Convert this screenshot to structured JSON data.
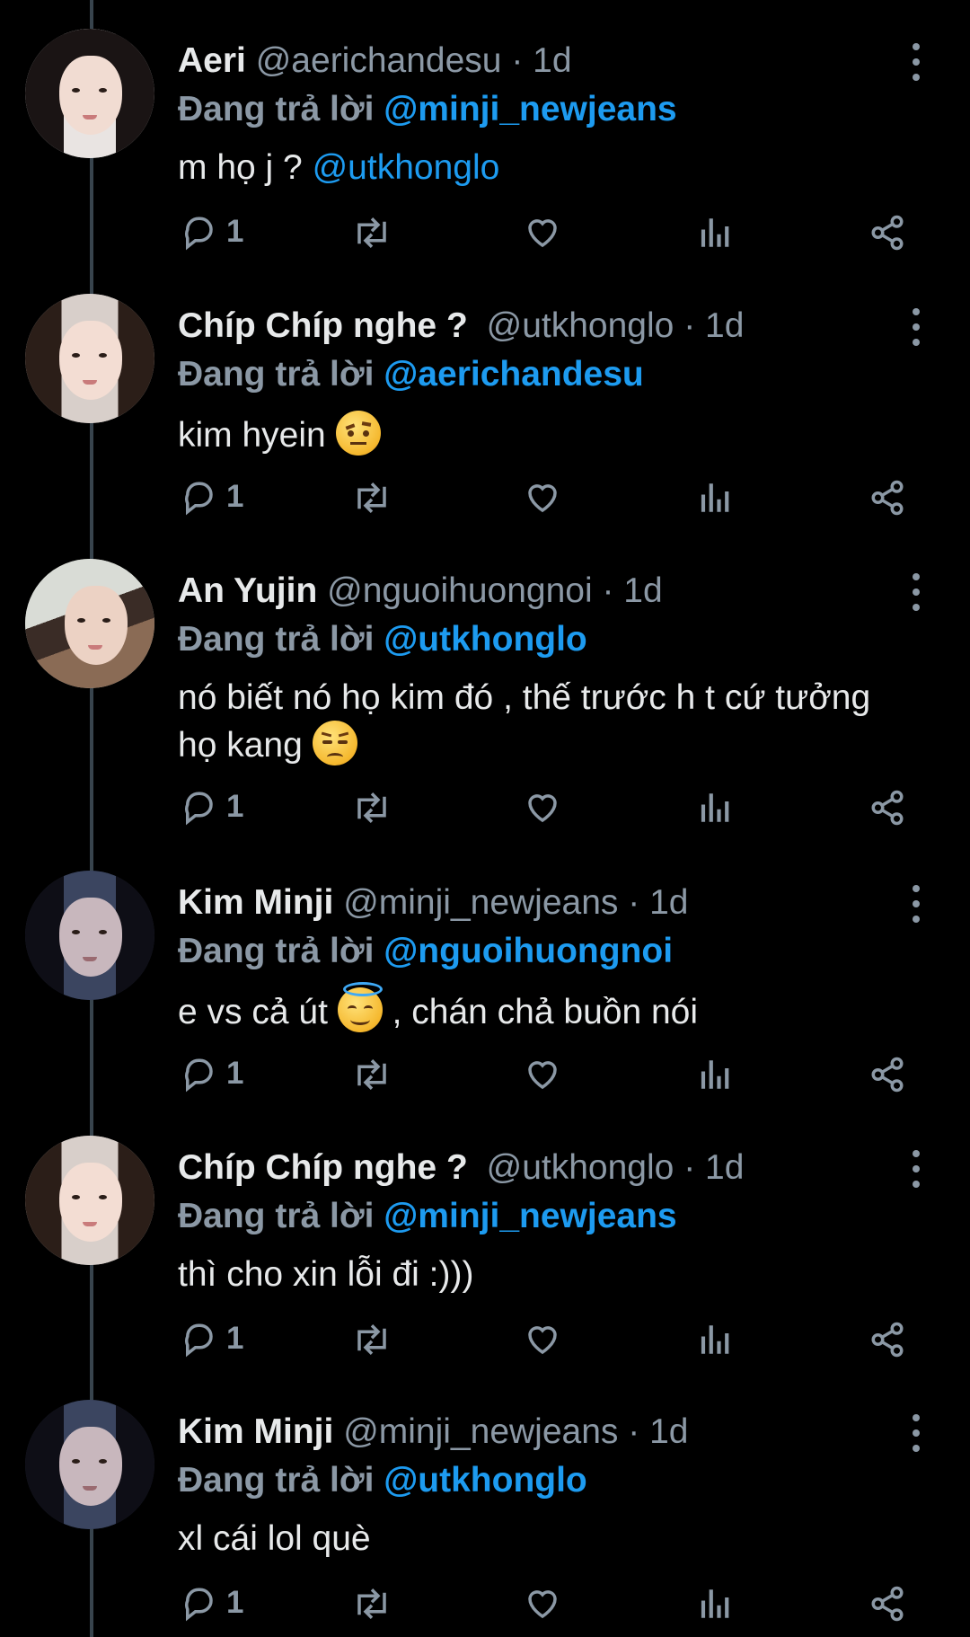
{
  "reply_prefix": "Đang trả lời",
  "tweets": [
    {
      "name": "Aeri",
      "handle": "@aerichandesu · 1d",
      "replying_to": "@minji_newjeans",
      "text_plain": "m họ j ? ",
      "text_mention": "@utkhonglo",
      "text_after": "",
      "reply_count": "1"
    },
    {
      "name": "Chíp Chíp nghe ?",
      "handle": "@utkhonglo · 1d",
      "replying_to": "@aerichandesu",
      "text_plain": "kim hyein ",
      "emoji": "raised-eyebrow-emoji",
      "reply_count": "1"
    },
    {
      "name": "An Yujin",
      "handle": "@nguoihuongnoi · 1d",
      "replying_to": "@utkhonglo",
      "text_line1": "nó biết nó họ kim đó , thế trước h t cứ tưởng",
      "text_line2": "họ kang ",
      "emoji": "unamused-emoji",
      "reply_count": "1"
    },
    {
      "name": "Kim Minji",
      "handle": "@minji_newjeans · 1d",
      "replying_to": "@nguoihuongnoi",
      "text_before": "e vs cả út ",
      "emoji": "halo-smile-emoji",
      "text_after": " , chán chả buồn nói",
      "reply_count": "1"
    },
    {
      "name": "Chíp Chíp nghe ?",
      "handle": "@utkhonglo · 1d",
      "replying_to": "@minji_newjeans",
      "text_plain": "thì cho xin lỗi đi :)))",
      "reply_count": "1"
    },
    {
      "name": "Kim Minji",
      "handle": "@minji_newjeans · 1d",
      "replying_to": "@utkhonglo",
      "text_plain": "xl cái lol què",
      "reply_count": "1"
    }
  ],
  "icons": {
    "reply": "reply-icon",
    "retweet": "retweet-icon",
    "like": "heart-icon",
    "views": "views-icon",
    "share": "share-icon",
    "more": "more-vertical-icon"
  },
  "colors": {
    "background": "#000000",
    "mention": "#1d9bf0",
    "secondary": "#8b98a5",
    "thread_line": "#38444d"
  }
}
